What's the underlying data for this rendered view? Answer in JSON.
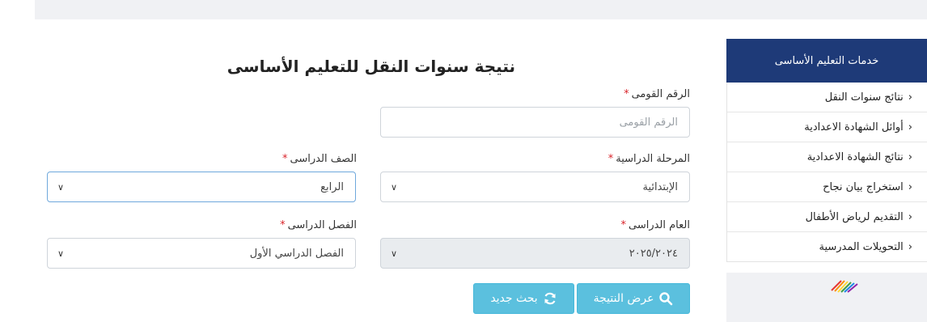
{
  "sidebar": {
    "header": "خدمات التعليم الأساسى",
    "items": [
      {
        "label": "نتائج سنوات النقل"
      },
      {
        "label": "أوائل الشهادة الاعدادية"
      },
      {
        "label": "نتائج الشهادة الاعدادية"
      },
      {
        "label": "استخراج بيان نجاح"
      },
      {
        "label": "التقديم لرياض الأطفال"
      },
      {
        "label": "التحويلات المدرسية"
      }
    ]
  },
  "form": {
    "title": "نتيجة سنوات النقل للتعليم الأساسى",
    "national_id": {
      "label": "الرقم القومى",
      "placeholder": "الرقم القومى"
    },
    "stage": {
      "label": "المرحلة الدراسية",
      "value": "الإبتدائية"
    },
    "grade": {
      "label": "الصف الدراسى",
      "value": "الرابع"
    },
    "year": {
      "label": "العام الدراسى",
      "value": "٢٠٢٥/٢٠٢٤"
    },
    "term": {
      "label": "الفصل الدراسى",
      "value": "الفصل الدراسي الأول"
    },
    "required_mark": "*",
    "show_result_label": "عرض النتيجة",
    "new_search_label": "بحث جديد"
  }
}
